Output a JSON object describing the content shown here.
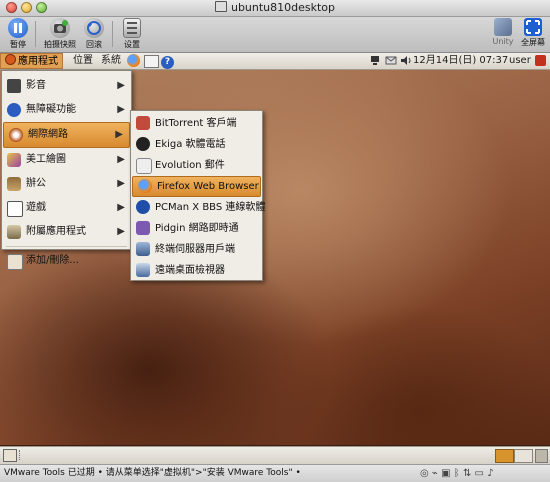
{
  "window": {
    "title": "ubuntu810desktop"
  },
  "toolbar": {
    "buttons": [
      {
        "label": "暂停",
        "icon": "pause-icon"
      },
      {
        "label": "拍摄快照",
        "icon": "snapshot-icon"
      },
      {
        "label": "回滚",
        "icon": "revert-icon"
      },
      {
        "label": "设置",
        "icon": "settings-icon"
      }
    ],
    "right": [
      {
        "label": "Unity",
        "icon": "unity-icon"
      },
      {
        "label": "全屏幕",
        "icon": "fullscreen-icon"
      }
    ]
  },
  "panel": {
    "menus": [
      "應用程式",
      "位置",
      "系統"
    ],
    "clock": "12月14日(日) 07:37",
    "user": "user"
  },
  "apps_menu": {
    "items": [
      {
        "label": "影音",
        "icon": "media-icon",
        "submenu": true
      },
      {
        "label": "無障礙功能",
        "icon": "accessibility-icon",
        "submenu": true
      },
      {
        "label": "網際網路",
        "icon": "internet-icon",
        "submenu": true,
        "active": true
      },
      {
        "label": "美工繪圖",
        "icon": "graphics-icon",
        "submenu": true
      },
      {
        "label": "辦公",
        "icon": "office-icon",
        "submenu": true
      },
      {
        "label": "遊戲",
        "icon": "games-icon",
        "submenu": true
      },
      {
        "label": "附屬應用程式",
        "icon": "accessories-icon",
        "submenu": true
      }
    ],
    "add_remove": "添加/刪除..."
  },
  "internet_menu": {
    "items": [
      {
        "label": "BitTorrent 客戶端",
        "icon": "bittorrent-icon"
      },
      {
        "label": "Ekiga 軟體電話",
        "icon": "ekiga-icon"
      },
      {
        "label": "Evolution 郵件",
        "icon": "evolution-icon"
      },
      {
        "label": "Firefox Web Browser",
        "icon": "firefox-icon",
        "active": true
      },
      {
        "label": "PCMan X BBS 連線軟體",
        "icon": "pcman-icon"
      },
      {
        "label": "Pidgin 網路即時通",
        "icon": "pidgin-icon"
      },
      {
        "label": "終端伺服器用戶端",
        "icon": "terminal-server-icon"
      },
      {
        "label": "遠端桌面檢視器",
        "icon": "remote-desktop-icon"
      }
    ]
  },
  "statusbar": {
    "text": "VMware Tools 已过期 • 请从菜单选择\"虚拟机\">\"安装 VMware Tools\" •"
  },
  "colors": {
    "accent": "#e1a052",
    "menu_bg": "#f0ede7"
  }
}
